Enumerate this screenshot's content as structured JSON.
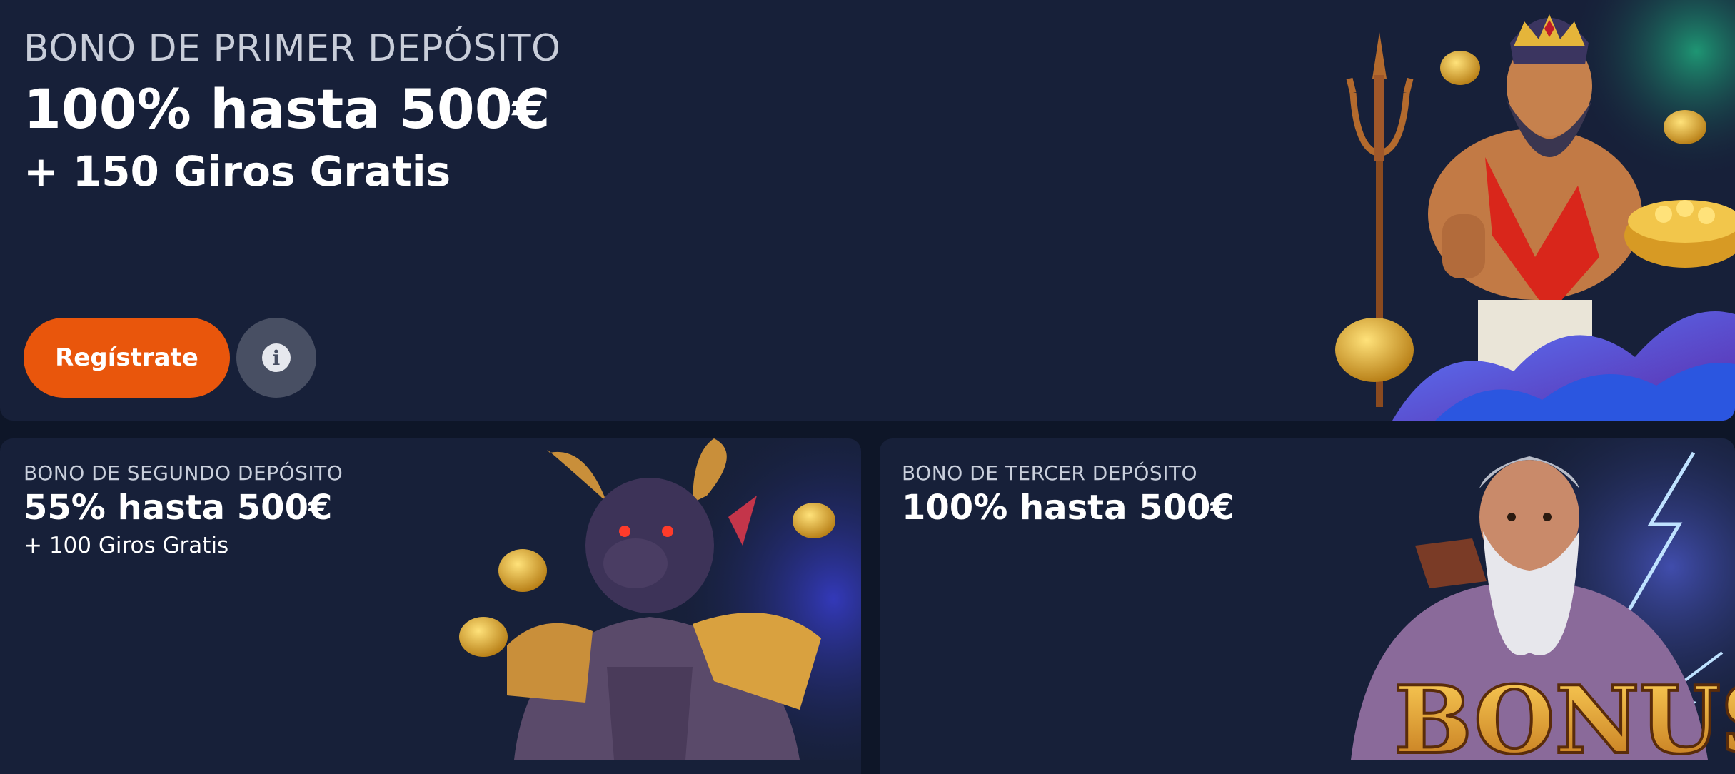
{
  "first_bonus": {
    "eyebrow": "BONO DE PRIMER DEPÓSITO",
    "headline": "100% hasta 500€",
    "subline": "+ 150 Giros Gratis",
    "register_label": "Regístrate",
    "info_glyph": "i"
  },
  "second_bonus": {
    "eyebrow": "BONO DE SEGUNDO DEPÓSITO",
    "headline": "55% hasta 500€",
    "subline": "+ 100 Giros Gratis"
  },
  "third_bonus": {
    "eyebrow": "BONO DE TERCER DEPÓSITO",
    "headline": "100% hasta 500€",
    "art_text": "BONUS"
  },
  "colors": {
    "page_bg": "#0e1628",
    "card_bg": "#172039",
    "accent_orange": "#e9560c",
    "info_button": "#484f63",
    "gold": "#e5b53a"
  },
  "icons": [
    "info-icon",
    "trident-icon",
    "coin-icon",
    "lightning-icon"
  ]
}
